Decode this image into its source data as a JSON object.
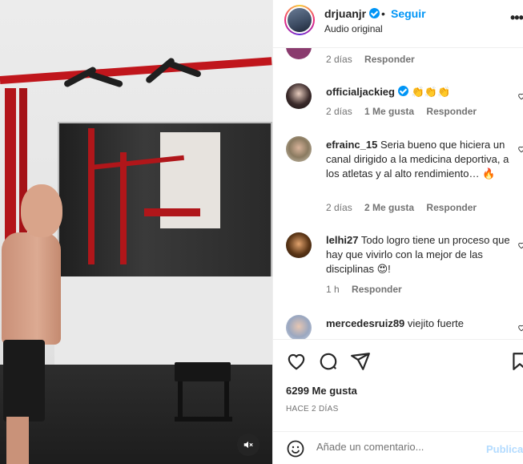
{
  "header": {
    "username": "drjuanjr",
    "separator": "•",
    "follow_label": "Seguir",
    "audio_label": "Audio original",
    "more_label": "•••"
  },
  "comments": [
    {
      "username": "",
      "text": "",
      "time": "2 días",
      "likes": "",
      "reply": "Responder"
    },
    {
      "username": "officialjackieg",
      "verified": true,
      "text": "👏👏👏",
      "time": "2 días",
      "likes": "1 Me gusta",
      "reply": "Responder"
    },
    {
      "username": "efrainc_15",
      "text": "Seria bueno que hiciera un canal dirigido a la medicina deportiva, a los atletas y al alto rendimiento… 🔥",
      "time": "2 días",
      "likes": "2 Me gusta",
      "reply": "Responder"
    },
    {
      "username": "lelhi27",
      "text": "Todo logro tiene un proceso que hay que vivirlo con la mejor de las disciplinas 😍!",
      "time": "1 h",
      "likes": "",
      "reply": "Responder"
    },
    {
      "username": "mercedesruiz89",
      "text": "viejito fuerte",
      "time": "",
      "likes": "",
      "reply": ""
    }
  ],
  "actions": {
    "like_icon": "heart-icon",
    "comment_icon": "comment-icon",
    "share_icon": "send-icon",
    "save_icon": "bookmark-icon"
  },
  "post": {
    "likes": "6299 Me gusta",
    "date": "HACE 2 DÍAS"
  },
  "comment_box": {
    "placeholder": "Añade un comentario...",
    "publish_label": "Publicar"
  },
  "colors": {
    "accent": "#0095f6",
    "publish_disabled": "#b3dbff",
    "muted_text": "#737373"
  }
}
